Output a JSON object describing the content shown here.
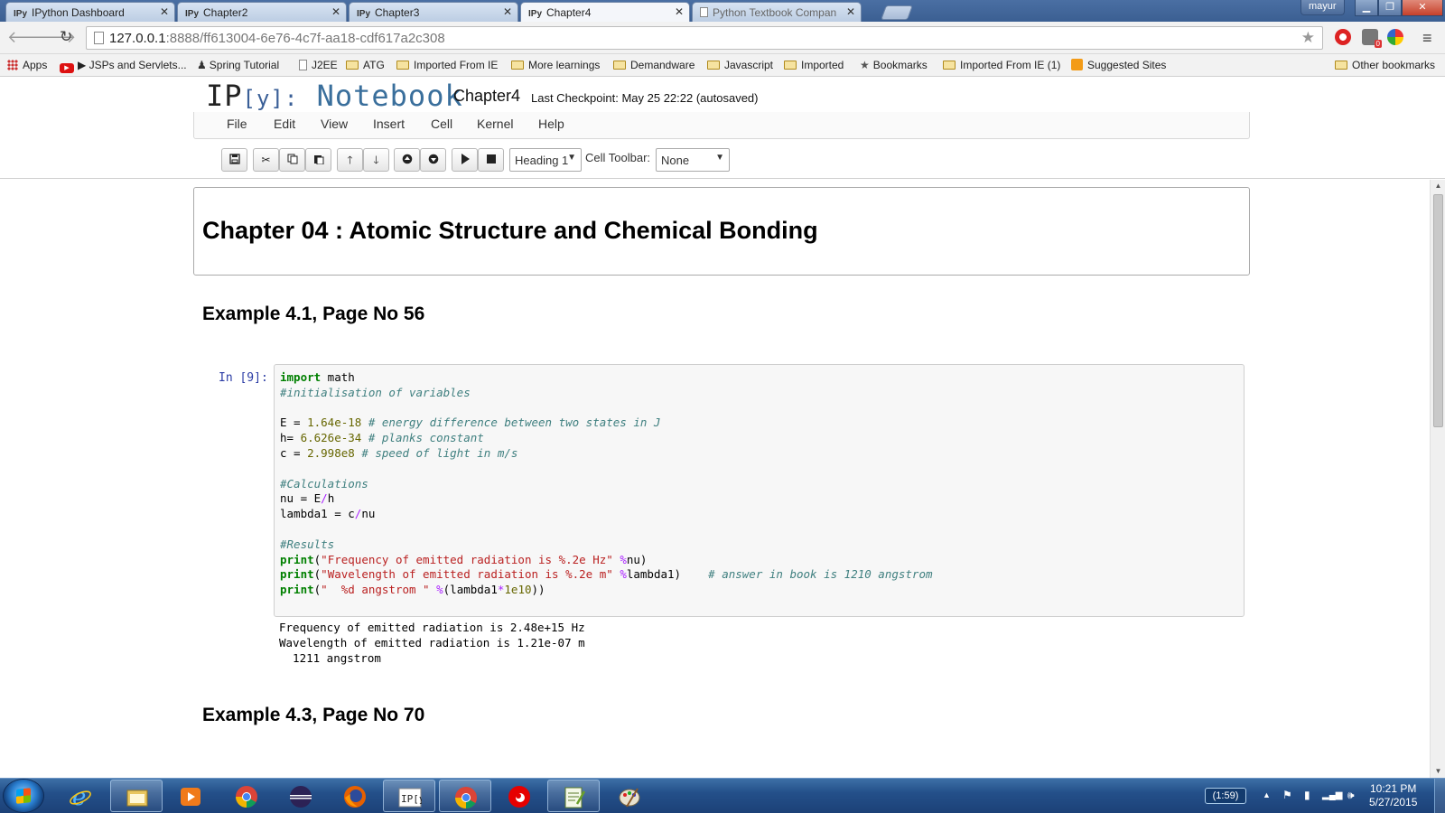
{
  "browser": {
    "tabs": [
      {
        "favicon": "IPy",
        "title": "IPython Dashboard",
        "active": false
      },
      {
        "favicon": "IPy",
        "title": "Chapter2",
        "active": false
      },
      {
        "favicon": "IPy",
        "title": "Chapter3",
        "active": false
      },
      {
        "favicon": "IPy",
        "title": "Chapter4",
        "active": true
      },
      {
        "favicon": "doc-icon",
        "title": "Python Textbook Compan",
        "active": false
      }
    ],
    "user": "mayur",
    "url_host": "127.0.0.1",
    "url_rest": ":8888/ff613004-6e76-4c7f-aa18-cdf617a2c308",
    "bookmarks": [
      {
        "icon": "apps-icon",
        "label": "Apps"
      },
      {
        "icon": "youtube-icon",
        "label": "▶ JSPs and Servlets..."
      },
      {
        "icon": "person-icon",
        "label": "Spring Tutorial"
      },
      {
        "icon": "page-icon",
        "label": "J2EE"
      },
      {
        "icon": "folder-icon",
        "label": "ATG"
      },
      {
        "icon": "folder-icon",
        "label": "Imported From IE"
      },
      {
        "icon": "folder-icon",
        "label": "More learnings"
      },
      {
        "icon": "folder-icon",
        "label": "Demandware"
      },
      {
        "icon": "folder-icon",
        "label": "Javascript"
      },
      {
        "icon": "folder-icon",
        "label": "Imported"
      },
      {
        "icon": "star-icon",
        "label": "Bookmarks"
      },
      {
        "icon": "folder-icon",
        "label": "Imported From IE (1)"
      },
      {
        "icon": "suggested-icon",
        "label": "Suggested Sites"
      },
      {
        "icon": "folder-icon",
        "label": "Other bookmarks"
      }
    ]
  },
  "notebook": {
    "logo_ip": "IP",
    "logo_bracket": "[y]:",
    "logo_nb": "Notebook",
    "name": "Chapter4",
    "checkpoint": "Last Checkpoint: May 25 22:22 (autosaved)",
    "menu": [
      "File",
      "Edit",
      "View",
      "Insert",
      "Cell",
      "Kernel",
      "Help"
    ],
    "cell_type": "Heading 1",
    "cell_toolbar_label": "Cell Toolbar:",
    "cell_toolbar_value": "None",
    "heading": "Chapter 04 : Atomic Structure and Chemical Bonding",
    "example1": "Example 4.1, Page No 56",
    "in_prompt": "In [9]:",
    "output_lines": [
      "Frequency of emitted radiation is 2.48e+15 Hz",
      "Wavelength of emitted radiation is 1.21e-07 m",
      "  1211 angstrom"
    ],
    "example2": "Example 4.3, Page No 70"
  },
  "taskbar": {
    "battery": "(1:59)",
    "time": "10:21 PM",
    "date": "5/27/2015"
  }
}
